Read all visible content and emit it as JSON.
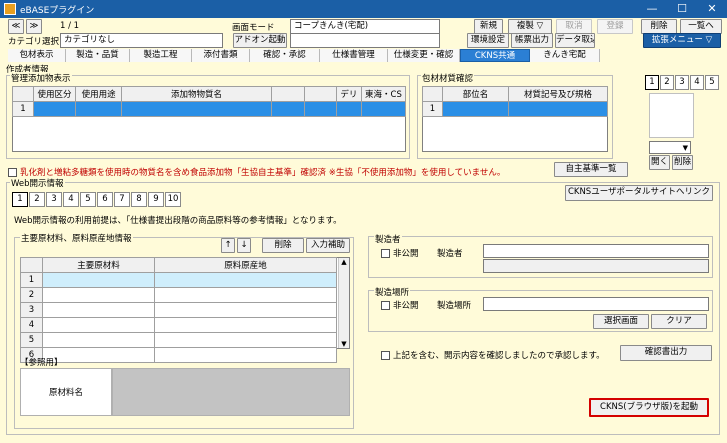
{
  "window": {
    "title": "eBASEプラグイン",
    "minimize": "—",
    "maximize": "☐",
    "close": "✕"
  },
  "toolbar": {
    "prev": "≪",
    "next": "≫",
    "page": "1 / 1",
    "screen_mode_label": "画面モード",
    "screen_mode_value": "コープきんき(宅配)",
    "category_select_label": "カテゴリ選択",
    "category_value": "カテゴリなし",
    "addon_launch": "アドオン起動",
    "new": "新規",
    "copy": "複製 ▽",
    "cancel": "取消",
    "register": "登録",
    "delete": "削除",
    "list": "一覧へ",
    "env_settings": "環境設定",
    "report_output": "帳票出力",
    "data_import": "データ取込",
    "ext_menu": "拡張メニュー ▽"
  },
  "tabs": [
    "包材表示",
    "製造・品質",
    "製造工程",
    "添付書類",
    "確認・承認",
    "仕様書管理",
    "仕様変更・確認",
    "CKNS共通",
    "きんき宅配"
  ],
  "active_tab": "CKNS共通",
  "creator_section": "作成者情報",
  "additive": {
    "title": "管理添加物表示",
    "headers": [
      "使用区分",
      "使用用途",
      "添加物物質名",
      "",
      "",
      "デリ",
      "東海・CS"
    ],
    "rows": [
      "1"
    ]
  },
  "packaging": {
    "title": "包材材質確認",
    "headers": [
      "部位名",
      "材質記号及び規格"
    ],
    "rows": [
      "1"
    ],
    "page_buttons": [
      "1",
      "2",
      "3",
      "4",
      "5"
    ],
    "open_btn": "開く",
    "delete_btn": "削除"
  },
  "notice": {
    "text": "乳化剤と増粘多糖類を使用時の物質名を含め食品添加物「生協自主基準」確認済 ※生協「不使用添加物」を使用していません。",
    "standard_list_btn": "自主基準一覧"
  },
  "web": {
    "title": "Web開示情報",
    "numbers": [
      "1",
      "2",
      "3",
      "4",
      "5",
      "6",
      "7",
      "8",
      "9",
      "10"
    ],
    "portal_btn": "CKNSユーザポータルサイトへリンク",
    "description": "Web開示情報の利用前提は、「仕様書提出段階の商品原料等の参考情報」となります。",
    "materials": {
      "title": "主要原材料、原料原産地情報",
      "up": "↑",
      "down": "↓",
      "delete": "削除",
      "input_assist": "入力補助",
      "headers": [
        "主要原材料",
        "原料原産地"
      ],
      "rows": [
        "1",
        "2",
        "3",
        "4",
        "5",
        "6"
      ]
    },
    "reference_label": "【参照用】",
    "material_name_label": "原材料名",
    "manufacturer": {
      "title": "製造者",
      "private": "非公開",
      "label": "製造者"
    },
    "place": {
      "title": "製造場所",
      "private": "非公開",
      "label": "製造場所",
      "select_btn": "選択画面",
      "clear_btn": "クリア"
    },
    "approval_text": "上記を含む、開示内容を確認しましたので承認します。",
    "confirm_output_btn": "確認書出力",
    "launch_btn": "CKNS(ブラウザ版)を起動"
  },
  "colors": {
    "titlebar": "#1b5fa6",
    "body_bg": "#fffbd9",
    "accent": "#2a8fe6",
    "notice": "#c00000",
    "highlight": "#d40000"
  }
}
